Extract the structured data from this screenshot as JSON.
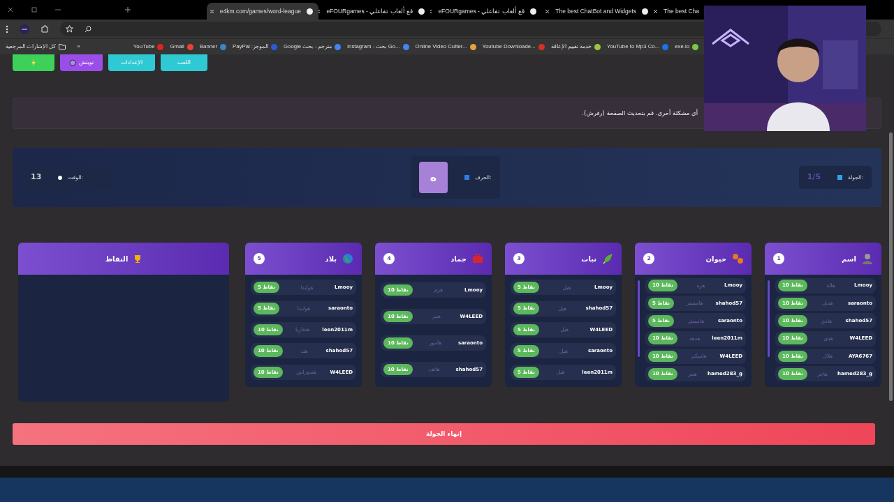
{
  "browser": {
    "tabs": [
      {
        "title": "The best Cha",
        "selected": false
      },
      {
        "title": "The best ChatBot and Widgets",
        "selected": false
      },
      {
        "title": "eFOURgames - قع ألعاب تفاعلي",
        "selected": false
      },
      {
        "title": "eFOURgames - قع ألعاب تفاعلي",
        "selected": false
      },
      {
        "title": "e4km.com/games/word-league",
        "selected": true
      }
    ],
    "bookmarks_folder": "كل الإشارات المرجعية",
    "more": "»",
    "bookmarks": [
      "exe.io",
      "YouTube to Mp3 Co...",
      "خدمة تقييم الإعاقة",
      "Youtube Downloade...",
      "Online Video Cutter...",
      "instagram - بحث Go...",
      "مترجم - بحث Google",
      "PayPal :الموجز",
      "Banner",
      "Gmail",
      "YouTube"
    ]
  },
  "top_buttons": [
    {
      "kind": "plain",
      "label": "اللعب"
    },
    {
      "kind": "plain",
      "label": "الإعدادات"
    },
    {
      "kind": "circle",
      "label": "تويتش"
    },
    {
      "kind": "lightning"
    }
  ],
  "notice": "أي مشكلة أخرى. قم بتحديث الصفحة (رفرش).",
  "status": {
    "round_label": "الجولة:",
    "round": "1/5",
    "letter_label": "الحرف:",
    "letter": "ه",
    "time_label": "الوقت:",
    "time": "13"
  },
  "categories": [
    {
      "name": "اسم",
      "number": "1",
      "rows": [
        {
          "player": "Lmooy",
          "answer": "هالة",
          "points": "10 نقاط"
        },
        {
          "player": "saraonto",
          "answer": "هديل",
          "points": "10 نقاط"
        },
        {
          "player": "shahod57",
          "answer": "هادي",
          "points": "10 نقاط"
        },
        {
          "player": "W4LEED",
          "answer": "هدى",
          "points": "10 نقاط"
        },
        {
          "player": "AYA6767",
          "answer": "هلال",
          "points": "10 نقاط"
        },
        {
          "player": "hamed283_g",
          "answer": "هاجر",
          "points": "10 نقاط"
        }
      ]
    },
    {
      "name": "حيوان",
      "number": "2",
      "rows": [
        {
          "player": "Lmooy",
          "answer": "هره",
          "points": "10 نقاط"
        },
        {
          "player": "shahod57",
          "answer": "هامستر",
          "points": "5 نقاط"
        },
        {
          "player": "saraonto",
          "answer": "هامستر",
          "points": "5 نقاط"
        },
        {
          "player": "leen2011m",
          "answer": "هدهد",
          "points": "10 نقاط"
        },
        {
          "player": "W4LEED",
          "answer": "هاسكي",
          "points": "10 نقاط"
        },
        {
          "player": "hamed283_g",
          "answer": "همر",
          "points": "10 نقاط"
        }
      ]
    },
    {
      "name": "نبات",
      "number": "3",
      "rows": [
        {
          "player": "Lmooy",
          "answer": "هيل",
          "points": "5 نقاط"
        },
        {
          "player": "shahod57",
          "answer": "هيل",
          "points": "5 نقاط"
        },
        {
          "player": "W4LEED",
          "answer": "هيل",
          "points": "5 نقاط"
        },
        {
          "player": "saraonto",
          "answer": "هيل",
          "points": "5 نقاط"
        },
        {
          "player": "leen2011m",
          "answer": "هيل",
          "points": "5 نقاط"
        }
      ]
    },
    {
      "name": "جماد",
      "number": "4",
      "rows": [
        {
          "player": "Lmooy",
          "answer": "هرم",
          "points": "10 نقاط"
        },
        {
          "player": "W4LEED",
          "answer": "همر",
          "points": "10 نقاط"
        },
        {
          "player": "saraonto",
          "answer": "هامور",
          "points": "10 نقاط"
        },
        {
          "player": "shahod57",
          "answer": "هاتف",
          "points": "10 نقاط"
        }
      ]
    },
    {
      "name": "بلاد",
      "number": "5",
      "rows": [
        {
          "player": "Lmooy",
          "answer": "هولندا",
          "points": "5 نقاط"
        },
        {
          "player": "saraonto",
          "answer": "هولندا",
          "points": "5 نقاط"
        },
        {
          "player": "leen2011m",
          "answer": "هنغاريا",
          "points": "10 نقاط"
        },
        {
          "player": "shahod57",
          "answer": "هند",
          "points": "10 نقاط"
        },
        {
          "player": "W4LEED",
          "answer": "هندوراس",
          "points": "10 نقاط"
        }
      ]
    }
  ],
  "points_panel": {
    "title": "النقاط"
  },
  "end_button": "إنهاء الجولة"
}
